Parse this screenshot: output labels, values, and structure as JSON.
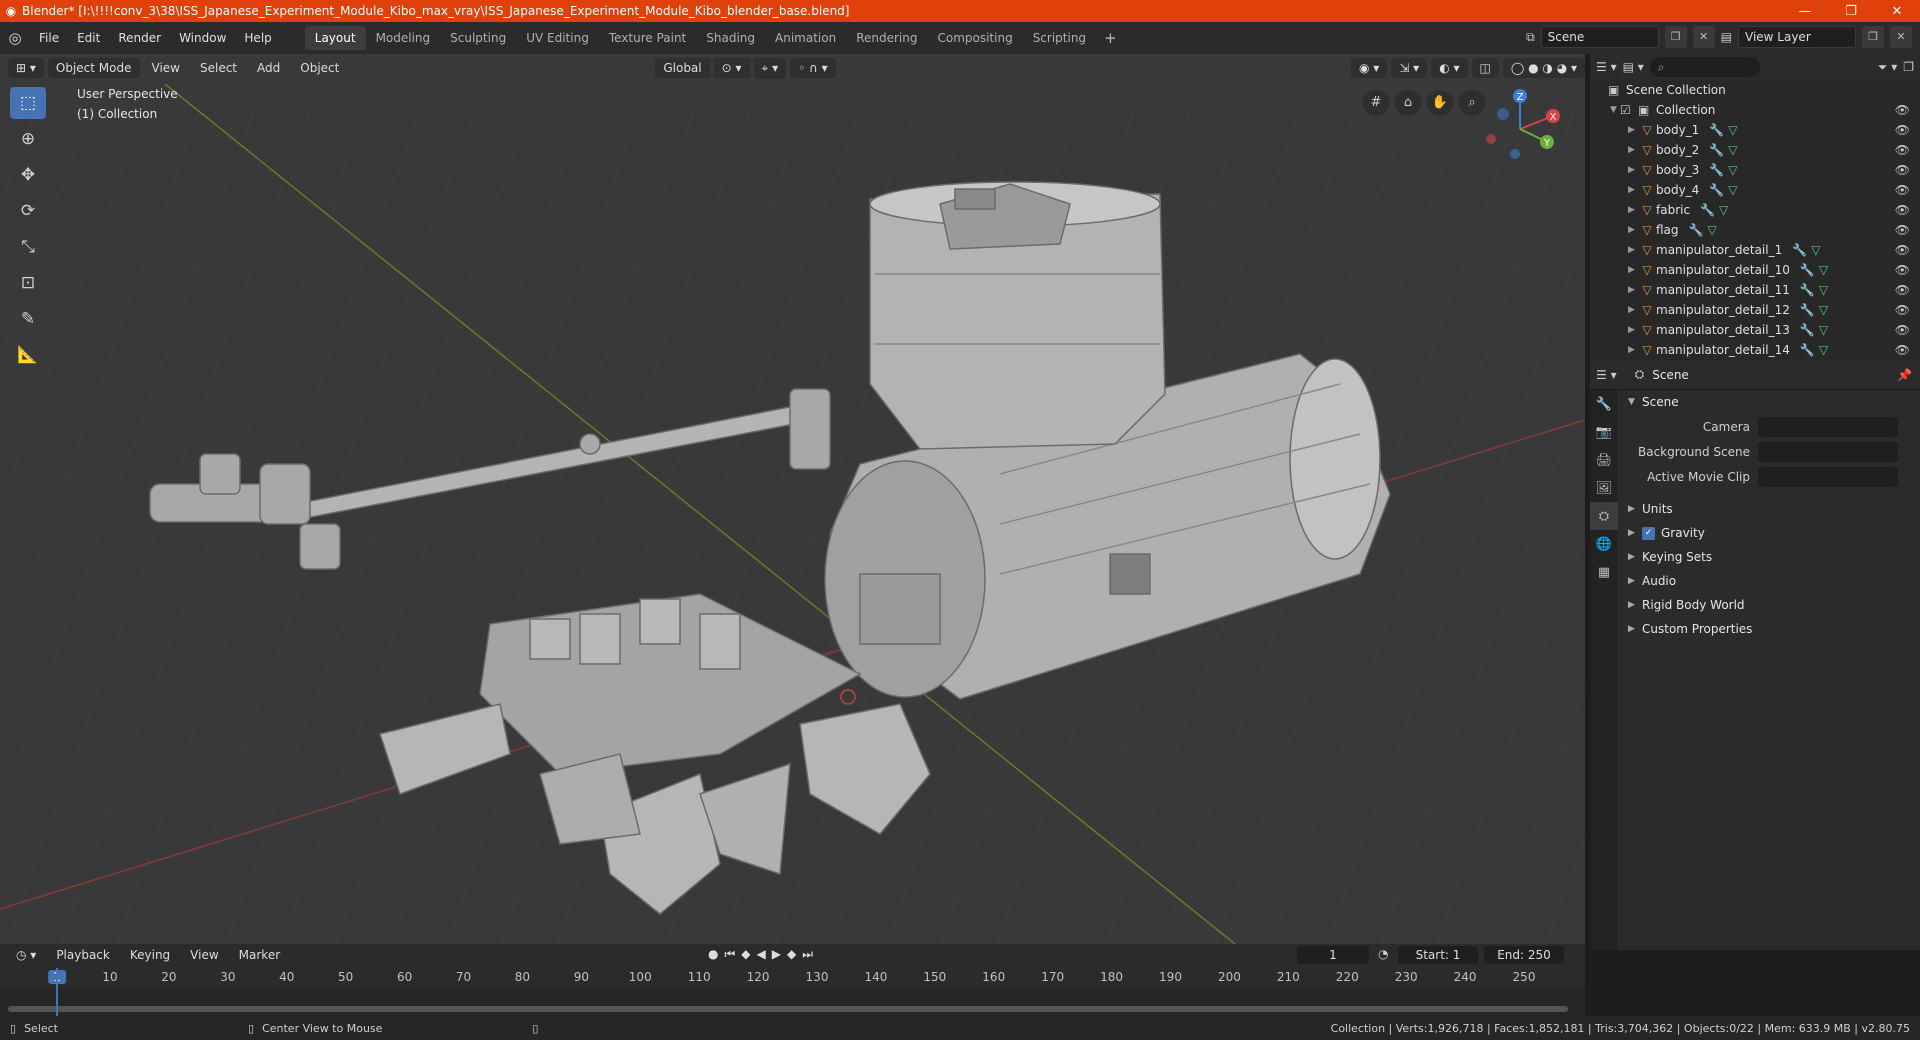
{
  "titlebar": {
    "title": "Blender* [I:\\!!!!conv_3\\38\\ISS_Japanese_Experiment_Module_Kibo_max_vray\\ISS_Japanese_Experiment_Module_Kibo_blender_base.blend]",
    "minimize": "—",
    "maximize": "❐",
    "close": "✕"
  },
  "menu": [
    "File",
    "Edit",
    "Render",
    "Window",
    "Help"
  ],
  "workspaces": [
    "Layout",
    "Modeling",
    "Sculpting",
    "UV Editing",
    "Texture Paint",
    "Shading",
    "Animation",
    "Rendering",
    "Compositing",
    "Scripting"
  ],
  "active_workspace": "Layout",
  "scene_field": "Scene",
  "view_layer_field": "View Layer",
  "viewport": {
    "mode": "Object Mode",
    "menus": [
      "View",
      "Select",
      "Add",
      "Object"
    ],
    "transform_orientation": "Global",
    "info_line1": "User Perspective",
    "info_line2": "(1) Collection",
    "gizmo_labels": [
      "X",
      "Y",
      "Z"
    ]
  },
  "outliner": {
    "root": "Scene Collection",
    "collection": "Collection",
    "items": [
      "body_1",
      "body_2",
      "body_3",
      "body_4",
      "fabric",
      "flag",
      "manipulator_detail_1",
      "manipulator_detail_10",
      "manipulator_detail_11",
      "manipulator_detail_12",
      "manipulator_detail_13",
      "manipulator_detail_14"
    ]
  },
  "properties": {
    "header_title": "Scene",
    "section_title": "Scene",
    "fields": [
      {
        "label": "Camera",
        "value": ""
      },
      {
        "label": "Background Scene",
        "value": ""
      },
      {
        "label": "Active Movie Clip",
        "value": ""
      }
    ],
    "subsections": [
      "Units",
      "Gravity",
      "Keying Sets",
      "Audio",
      "Rigid Body World",
      "Custom Properties"
    ]
  },
  "timeline": {
    "menus": [
      "Playback",
      "Keying",
      "View",
      "Marker"
    ],
    "current_frame": "1",
    "start_label": "Start:",
    "start": "1",
    "end_label": "End:",
    "end": "250",
    "ticks": [
      "1",
      "10",
      "20",
      "30",
      "40",
      "50",
      "60",
      "70",
      "80",
      "90",
      "100",
      "110",
      "120",
      "130",
      "140",
      "150",
      "160",
      "170",
      "180",
      "190",
      "200",
      "210",
      "220",
      "230",
      "240",
      "250"
    ]
  },
  "statusbar": {
    "left1": "Select",
    "left2": "Center View to Mouse",
    "right": "Collection | Verts:1,926,718 | Faces:1,852,181 | Tris:3,704,362 | Objects:0/22 | Mem: 633.9 MB | v2.80.75"
  }
}
